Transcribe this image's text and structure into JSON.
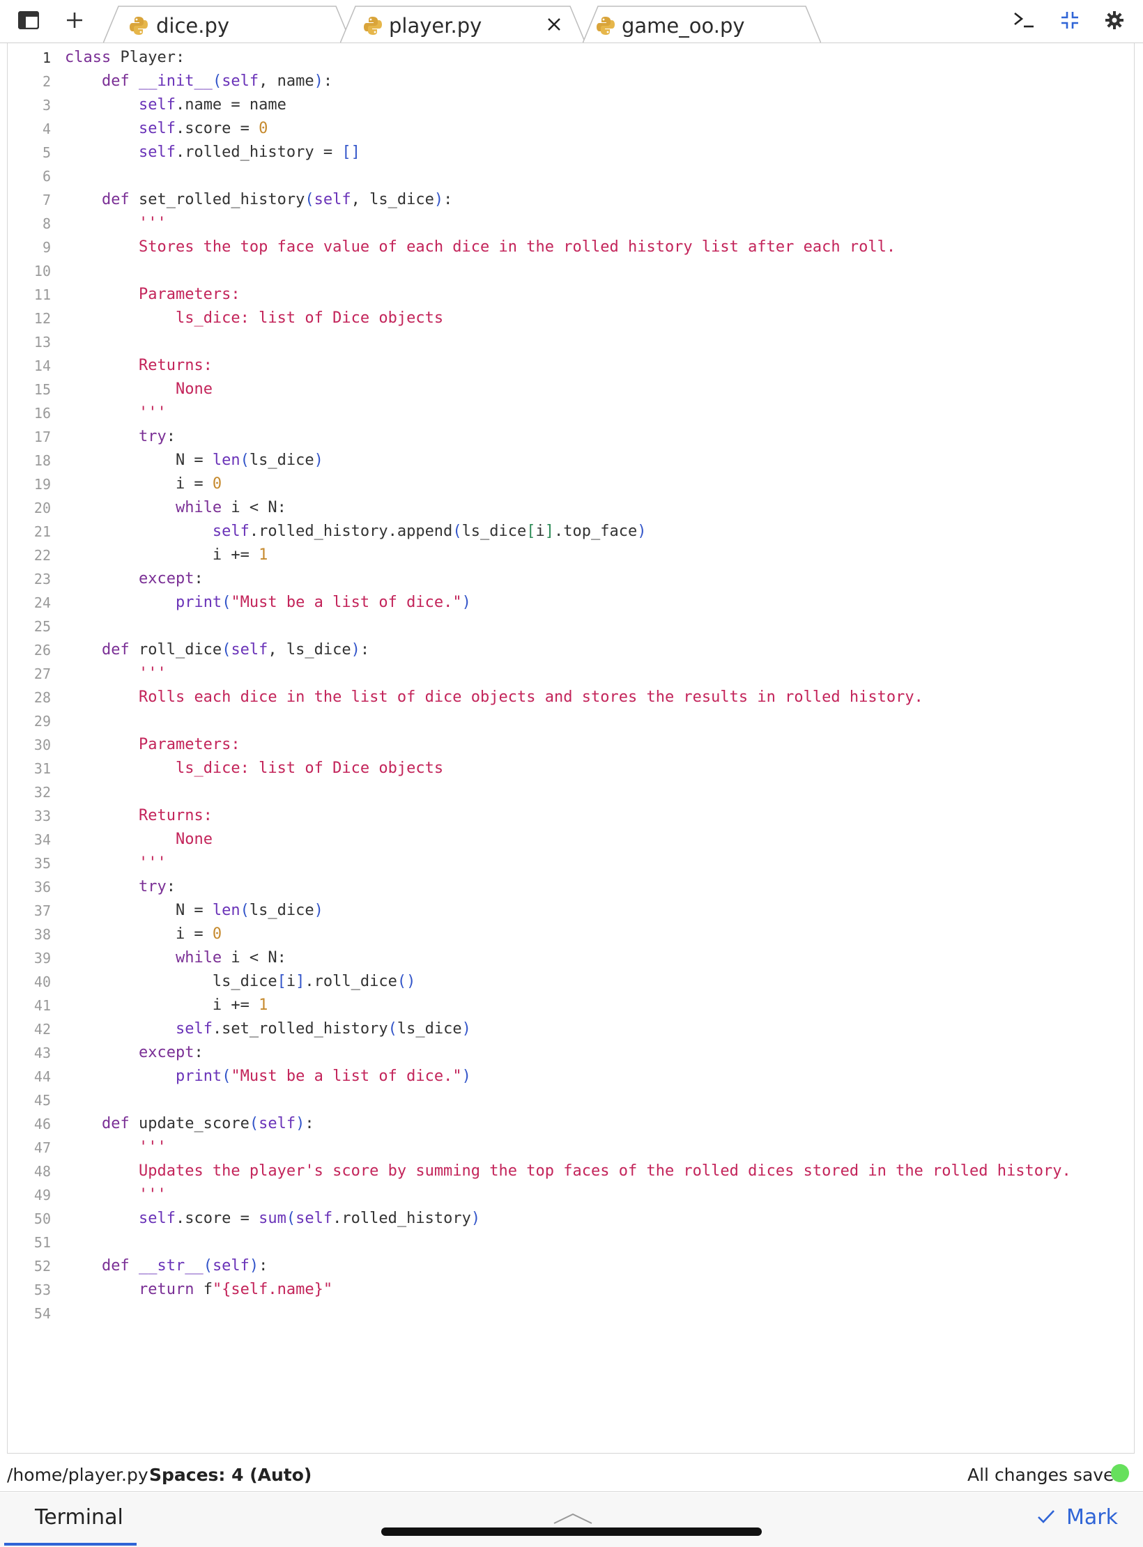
{
  "tabs": [
    {
      "label": "dice.py",
      "active": false
    },
    {
      "label": "player.py",
      "active": true
    },
    {
      "label": "game_oo.py",
      "active": false
    }
  ],
  "editor": {
    "lines": [
      [
        {
          "t": "class ",
          "c": "kw"
        },
        {
          "t": "Player:"
        }
      ],
      [
        {
          "t": "    "
        },
        {
          "t": "def ",
          "c": "kw"
        },
        {
          "t": "__init__",
          "c": "sf"
        },
        {
          "t": "(",
          "c": "bl"
        },
        {
          "t": "self",
          "c": "sf"
        },
        {
          "t": ", name"
        },
        {
          "t": ")",
          "c": "bl"
        },
        {
          "t": ":"
        }
      ],
      [
        {
          "t": "        "
        },
        {
          "t": "self",
          "c": "sf"
        },
        {
          "t": ".name = name"
        }
      ],
      [
        {
          "t": "        "
        },
        {
          "t": "self",
          "c": "sf"
        },
        {
          "t": ".score = "
        },
        {
          "t": "0",
          "c": "nm"
        }
      ],
      [
        {
          "t": "        "
        },
        {
          "t": "self",
          "c": "sf"
        },
        {
          "t": ".rolled_history = "
        },
        {
          "t": "[]",
          "c": "bl"
        }
      ],
      [],
      [
        {
          "t": "    "
        },
        {
          "t": "def ",
          "c": "kw"
        },
        {
          "t": "set_rolled_history"
        },
        {
          "t": "(",
          "c": "bl"
        },
        {
          "t": "self",
          "c": "sf"
        },
        {
          "t": ", ls_dice"
        },
        {
          "t": ")",
          "c": "bl"
        },
        {
          "t": ":"
        }
      ],
      [
        {
          "t": "        "
        },
        {
          "t": "'''",
          "c": "st"
        }
      ],
      [
        {
          "t": "        "
        },
        {
          "t": "Stores the top face value of each dice in the rolled history list after each roll.",
          "c": "st"
        }
      ],
      [],
      [
        {
          "t": "        "
        },
        {
          "t": "Parameters:",
          "c": "st"
        }
      ],
      [
        {
          "t": "            "
        },
        {
          "t": "ls_dice: list of Dice objects",
          "c": "st"
        }
      ],
      [],
      [
        {
          "t": "        "
        },
        {
          "t": "Returns:",
          "c": "st"
        }
      ],
      [
        {
          "t": "            "
        },
        {
          "t": "None",
          "c": "st"
        }
      ],
      [
        {
          "t": "        "
        },
        {
          "t": "'''",
          "c": "st"
        }
      ],
      [
        {
          "t": "        "
        },
        {
          "t": "try",
          "c": "kw"
        },
        {
          "t": ":"
        }
      ],
      [
        {
          "t": "            N = "
        },
        {
          "t": "len",
          "c": "sf"
        },
        {
          "t": "(",
          "c": "bl"
        },
        {
          "t": "ls_dice"
        },
        {
          "t": ")",
          "c": "bl"
        }
      ],
      [
        {
          "t": "            i = "
        },
        {
          "t": "0",
          "c": "nm"
        }
      ],
      [
        {
          "t": "            "
        },
        {
          "t": "while",
          "c": "kw"
        },
        {
          "t": " i < N:"
        }
      ],
      [
        {
          "t": "                "
        },
        {
          "t": "self",
          "c": "sf"
        },
        {
          "t": ".rolled_history.append"
        },
        {
          "t": "(",
          "c": "bl"
        },
        {
          "t": "ls_dice"
        },
        {
          "t": "[",
          "c": "br"
        },
        {
          "t": "i"
        },
        {
          "t": "]",
          "c": "br"
        },
        {
          "t": ".top_face"
        },
        {
          "t": ")",
          "c": "bl"
        }
      ],
      [
        {
          "t": "                i += "
        },
        {
          "t": "1",
          "c": "nm"
        }
      ],
      [
        {
          "t": "        "
        },
        {
          "t": "except",
          "c": "kw"
        },
        {
          "t": ":"
        }
      ],
      [
        {
          "t": "            "
        },
        {
          "t": "print",
          "c": "sf"
        },
        {
          "t": "(",
          "c": "bl"
        },
        {
          "t": "\"Must be a list of dice.\"",
          "c": "st"
        },
        {
          "t": ")",
          "c": "bl"
        }
      ],
      [],
      [
        {
          "t": "    "
        },
        {
          "t": "def ",
          "c": "kw"
        },
        {
          "t": "roll_dice"
        },
        {
          "t": "(",
          "c": "bl"
        },
        {
          "t": "self",
          "c": "sf"
        },
        {
          "t": ", ls_dice"
        },
        {
          "t": ")",
          "c": "bl"
        },
        {
          "t": ":"
        }
      ],
      [
        {
          "t": "        "
        },
        {
          "t": "'''",
          "c": "st"
        }
      ],
      [
        {
          "t": "        "
        },
        {
          "t": "Rolls each dice in the list of dice objects and stores the results in rolled history.",
          "c": "st"
        }
      ],
      [],
      [
        {
          "t": "        "
        },
        {
          "t": "Parameters:",
          "c": "st"
        }
      ],
      [
        {
          "t": "            "
        },
        {
          "t": "ls_dice: list of Dice objects",
          "c": "st"
        }
      ],
      [],
      [
        {
          "t": "        "
        },
        {
          "t": "Returns:",
          "c": "st"
        }
      ],
      [
        {
          "t": "            "
        },
        {
          "t": "None",
          "c": "st"
        }
      ],
      [
        {
          "t": "        "
        },
        {
          "t": "'''",
          "c": "st"
        }
      ],
      [
        {
          "t": "        "
        },
        {
          "t": "try",
          "c": "kw"
        },
        {
          "t": ":"
        }
      ],
      [
        {
          "t": "            N = "
        },
        {
          "t": "len",
          "c": "sf"
        },
        {
          "t": "(",
          "c": "bl"
        },
        {
          "t": "ls_dice"
        },
        {
          "t": ")",
          "c": "bl"
        }
      ],
      [
        {
          "t": "            i = "
        },
        {
          "t": "0",
          "c": "nm"
        }
      ],
      [
        {
          "t": "            "
        },
        {
          "t": "while",
          "c": "kw"
        },
        {
          "t": " i < N:"
        }
      ],
      [
        {
          "t": "                ls_dice"
        },
        {
          "t": "[",
          "c": "bl"
        },
        {
          "t": "i"
        },
        {
          "t": "]",
          "c": "bl"
        },
        {
          "t": ".roll_dice"
        },
        {
          "t": "()",
          "c": "bl"
        }
      ],
      [
        {
          "t": "                i += "
        },
        {
          "t": "1",
          "c": "nm"
        }
      ],
      [
        {
          "t": "            "
        },
        {
          "t": "self",
          "c": "sf"
        },
        {
          "t": ".set_rolled_history"
        },
        {
          "t": "(",
          "c": "bl"
        },
        {
          "t": "ls_dice"
        },
        {
          "t": ")",
          "c": "bl"
        }
      ],
      [
        {
          "t": "        "
        },
        {
          "t": "except",
          "c": "kw"
        },
        {
          "t": ":"
        }
      ],
      [
        {
          "t": "            "
        },
        {
          "t": "print",
          "c": "sf"
        },
        {
          "t": "(",
          "c": "bl"
        },
        {
          "t": "\"Must be a list of dice.\"",
          "c": "st"
        },
        {
          "t": ")",
          "c": "bl"
        }
      ],
      [],
      [
        {
          "t": "    "
        },
        {
          "t": "def ",
          "c": "kw"
        },
        {
          "t": "update_score"
        },
        {
          "t": "(",
          "c": "bl"
        },
        {
          "t": "self",
          "c": "sf"
        },
        {
          "t": ")",
          "c": "bl"
        },
        {
          "t": ":"
        }
      ],
      [
        {
          "t": "        "
        },
        {
          "t": "'''",
          "c": "st"
        }
      ],
      [
        {
          "t": "        "
        },
        {
          "t": "Updates the player's score by summing the top faces of the rolled dices stored in the rolled history.",
          "c": "st"
        }
      ],
      [
        {
          "t": "        "
        },
        {
          "t": "'''",
          "c": "st"
        }
      ],
      [
        {
          "t": "        "
        },
        {
          "t": "self",
          "c": "sf"
        },
        {
          "t": ".score = "
        },
        {
          "t": "sum",
          "c": "sf"
        },
        {
          "t": "(",
          "c": "bl"
        },
        {
          "t": "self",
          "c": "sf"
        },
        {
          "t": ".rolled_history"
        },
        {
          "t": ")",
          "c": "bl"
        }
      ],
      [],
      [
        {
          "t": "    "
        },
        {
          "t": "def ",
          "c": "kw"
        },
        {
          "t": "__str__",
          "c": "sf"
        },
        {
          "t": "(",
          "c": "bl"
        },
        {
          "t": "self",
          "c": "sf"
        },
        {
          "t": ")",
          "c": "bl"
        },
        {
          "t": ":"
        }
      ],
      [
        {
          "t": "        "
        },
        {
          "t": "return ",
          "c": "kw"
        },
        {
          "t": "f"
        },
        {
          "t": "\"{self.name}\"",
          "c": "st"
        }
      ],
      []
    ]
  },
  "status": {
    "path": "/home/player.py",
    "spaces": "Spaces: 4 (Auto)",
    "saved": "All changes saved",
    "saved_color": "#66e05c"
  },
  "bottom": {
    "terminal_label": "Terminal",
    "mark_label": "Mark"
  },
  "icons": {
    "sidebar": "sidebar-icon",
    "add": "plus-icon",
    "terminal": "terminal-icon",
    "collapse": "collapse-icon",
    "settings": "gear-icon",
    "python": "python-file-icon"
  },
  "colors": {
    "accent": "#2f64d6",
    "keyword": "#7a2f95",
    "string": "#c3245a",
    "number": "#c68a2e"
  }
}
